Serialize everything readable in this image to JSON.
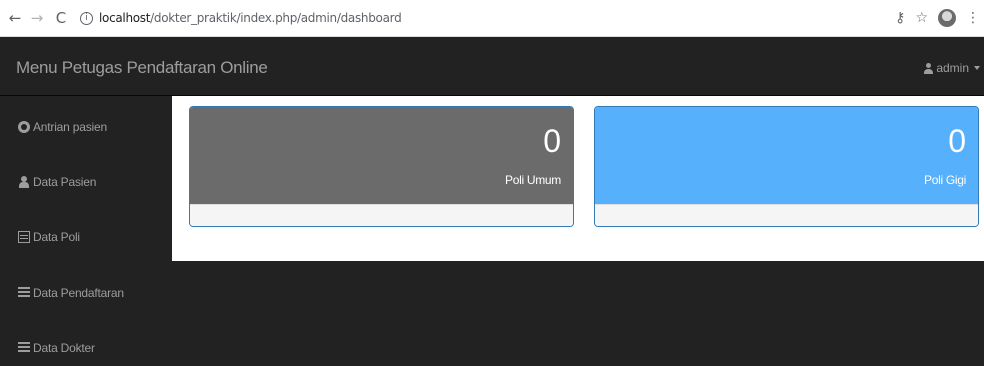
{
  "browser": {
    "url_host": "localhost",
    "url_path": "/dokter_praktik/index.php/admin/dashboard"
  },
  "navbar": {
    "brand": "Menu Petugas Pendaftaran Online",
    "user_label": "admin"
  },
  "sidebar": {
    "items": [
      {
        "label": "Antrian pasien",
        "icon": "dashboard-icon"
      },
      {
        "label": "Data Pasien",
        "icon": "user-icon"
      },
      {
        "label": "Data Poli",
        "icon": "book-icon"
      },
      {
        "label": "Data Pendaftaran",
        "icon": "list-icon"
      },
      {
        "label": "Data Dokter",
        "icon": "list-icon"
      }
    ]
  },
  "panels": [
    {
      "count": "0",
      "label": "Poli Umum",
      "color": "#6b6b6b"
    },
    {
      "count": "0",
      "label": "Poli Gigi",
      "color": "#56b0fc"
    }
  ]
}
